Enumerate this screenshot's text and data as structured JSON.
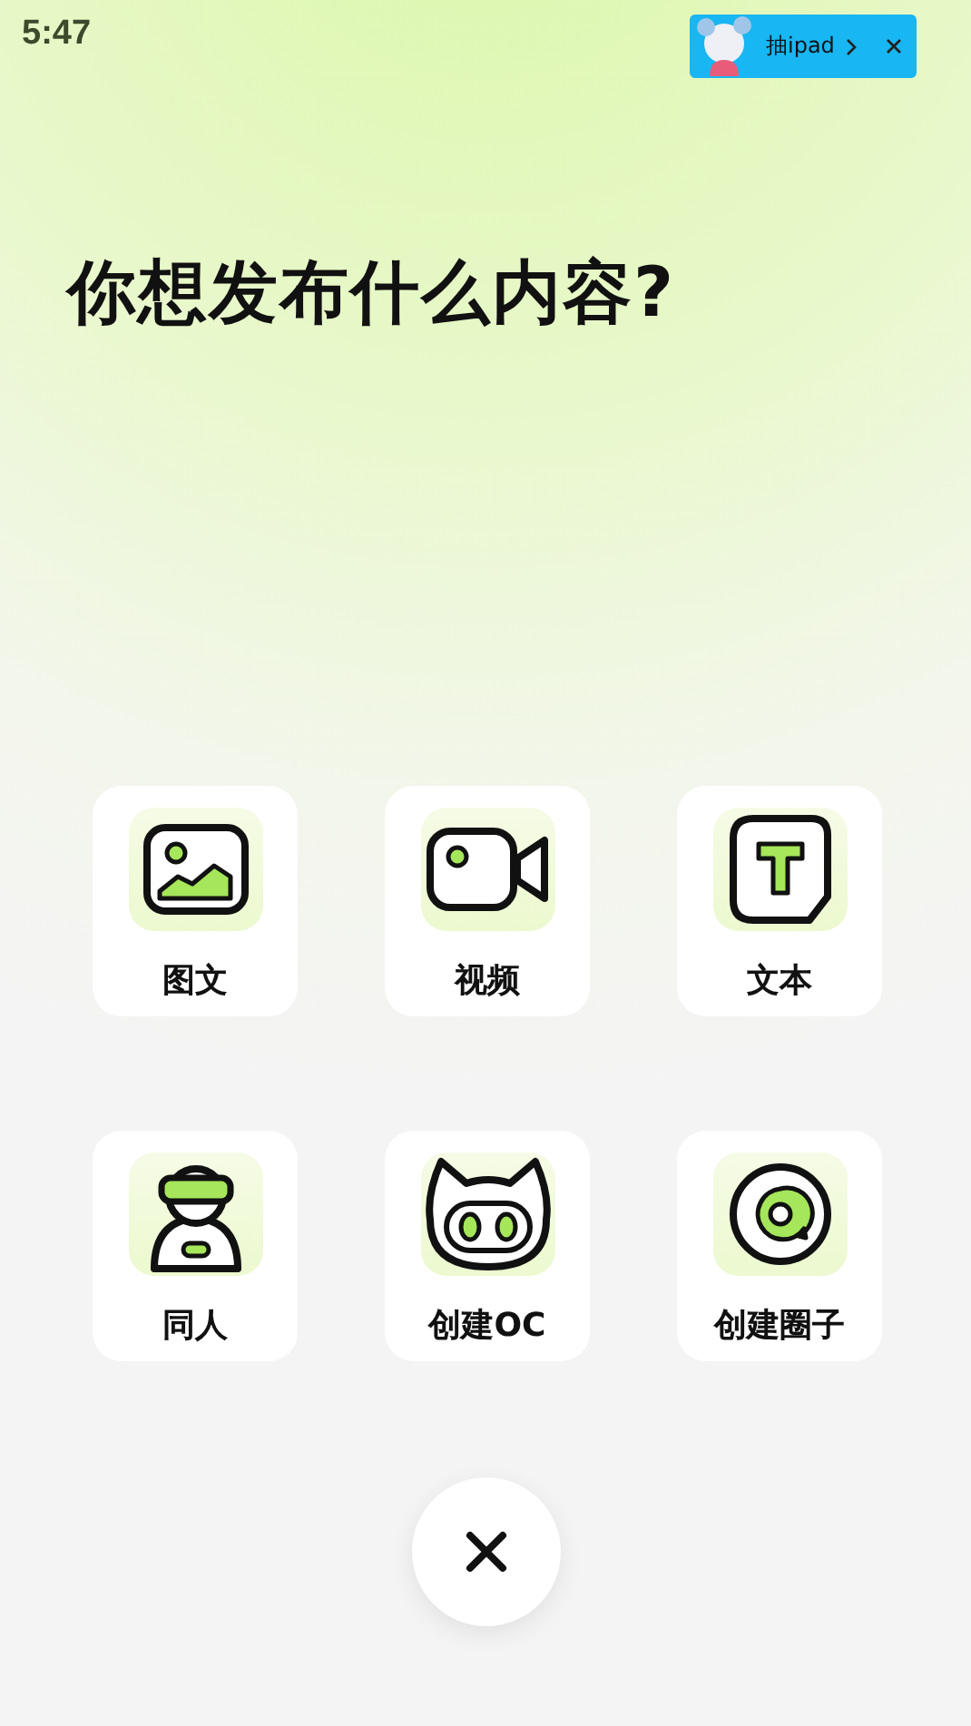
{
  "status_bar": {
    "time": "5:47"
  },
  "promo_banner": {
    "text": "抽ipad"
  },
  "title": "你想发布什么内容?",
  "options": [
    {
      "label": "图文",
      "kind": "image"
    },
    {
      "label": "视频",
      "kind": "video"
    },
    {
      "label": "文本",
      "kind": "text"
    },
    {
      "label": "同人",
      "kind": "person"
    },
    {
      "label": "创建OC",
      "kind": "cat"
    },
    {
      "label": "创建圈子",
      "kind": "circle"
    }
  ]
}
